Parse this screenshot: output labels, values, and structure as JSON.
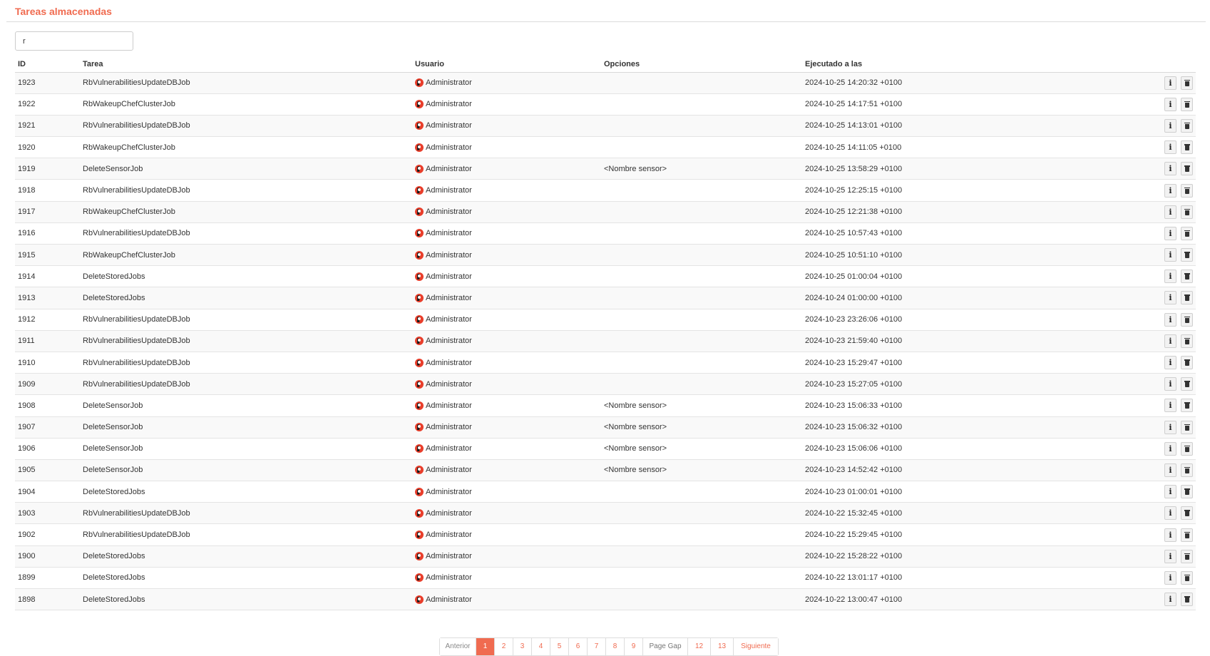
{
  "page": {
    "title": "Tareas almacenadas"
  },
  "search": {
    "value": "r"
  },
  "table": {
    "columns": [
      "ID",
      "Tarea",
      "Usuario",
      "Opciones",
      "Ejecutado a las"
    ],
    "rows": [
      {
        "id": "1923",
        "task": "RbVulnerabilitiesUpdateDBJob",
        "user": "Administrator",
        "options": "",
        "executed_at": "2024-10-25 14:20:32 +0100"
      },
      {
        "id": "1922",
        "task": "RbWakeupChefClusterJob",
        "user": "Administrator",
        "options": "",
        "executed_at": "2024-10-25 14:17:51 +0100"
      },
      {
        "id": "1921",
        "task": "RbVulnerabilitiesUpdateDBJob",
        "user": "Administrator",
        "options": "",
        "executed_at": "2024-10-25 14:13:01 +0100"
      },
      {
        "id": "1920",
        "task": "RbWakeupChefClusterJob",
        "user": "Administrator",
        "options": "",
        "executed_at": "2024-10-25 14:11:05 +0100"
      },
      {
        "id": "1919",
        "task": "DeleteSensorJob",
        "user": "Administrator",
        "options": "<Nombre sensor>",
        "executed_at": "2024-10-25 13:58:29 +0100"
      },
      {
        "id": "1918",
        "task": "RbVulnerabilitiesUpdateDBJob",
        "user": "Administrator",
        "options": "",
        "executed_at": "2024-10-25 12:25:15 +0100"
      },
      {
        "id": "1917",
        "task": "RbWakeupChefClusterJob",
        "user": "Administrator",
        "options": "",
        "executed_at": "2024-10-25 12:21:38 +0100"
      },
      {
        "id": "1916",
        "task": "RbVulnerabilitiesUpdateDBJob",
        "user": "Administrator",
        "options": "",
        "executed_at": "2024-10-25 10:57:43 +0100"
      },
      {
        "id": "1915",
        "task": "RbWakeupChefClusterJob",
        "user": "Administrator",
        "options": "",
        "executed_at": "2024-10-25 10:51:10 +0100"
      },
      {
        "id": "1914",
        "task": "DeleteStoredJobs",
        "user": "Administrator",
        "options": "",
        "executed_at": "2024-10-25 01:00:04 +0100"
      },
      {
        "id": "1913",
        "task": "DeleteStoredJobs",
        "user": "Administrator",
        "options": "",
        "executed_at": "2024-10-24 01:00:00 +0100"
      },
      {
        "id": "1912",
        "task": "RbVulnerabilitiesUpdateDBJob",
        "user": "Administrator",
        "options": "",
        "executed_at": "2024-10-23 23:26:06 +0100"
      },
      {
        "id": "1911",
        "task": "RbVulnerabilitiesUpdateDBJob",
        "user": "Administrator",
        "options": "",
        "executed_at": "2024-10-23 21:59:40 +0100"
      },
      {
        "id": "1910",
        "task": "RbVulnerabilitiesUpdateDBJob",
        "user": "Administrator",
        "options": "",
        "executed_at": "2024-10-23 15:29:47 +0100"
      },
      {
        "id": "1909",
        "task": "RbVulnerabilitiesUpdateDBJob",
        "user": "Administrator",
        "options": "",
        "executed_at": "2024-10-23 15:27:05 +0100"
      },
      {
        "id": "1908",
        "task": "DeleteSensorJob",
        "user": "Administrator",
        "options": "<Nombre sensor>",
        "executed_at": "2024-10-23 15:06:33 +0100"
      },
      {
        "id": "1907",
        "task": "DeleteSensorJob",
        "user": "Administrator",
        "options": "<Nombre sensor>",
        "executed_at": "2024-10-23 15:06:32 +0100"
      },
      {
        "id": "1906",
        "task": "DeleteSensorJob",
        "user": "Administrator",
        "options": "<Nombre sensor>",
        "executed_at": "2024-10-23 15:06:06 +0100"
      },
      {
        "id": "1905",
        "task": "DeleteSensorJob",
        "user": "Administrator",
        "options": "<Nombre sensor>",
        "executed_at": "2024-10-23 14:52:42 +0100"
      },
      {
        "id": "1904",
        "task": "DeleteStoredJobs",
        "user": "Administrator",
        "options": "",
        "executed_at": "2024-10-23 01:00:01 +0100"
      },
      {
        "id": "1903",
        "task": "RbVulnerabilitiesUpdateDBJob",
        "user": "Administrator",
        "options": "",
        "executed_at": "2024-10-22 15:32:45 +0100"
      },
      {
        "id": "1902",
        "task": "RbVulnerabilitiesUpdateDBJob",
        "user": "Administrator",
        "options": "",
        "executed_at": "2024-10-22 15:29:45 +0100"
      },
      {
        "id": "1900",
        "task": "DeleteStoredJobs",
        "user": "Administrator",
        "options": "",
        "executed_at": "2024-10-22 15:28:22 +0100"
      },
      {
        "id": "1899",
        "task": "DeleteStoredJobs",
        "user": "Administrator",
        "options": "",
        "executed_at": "2024-10-22 13:01:17 +0100"
      },
      {
        "id": "1898",
        "task": "DeleteStoredJobs",
        "user": "Administrator",
        "options": "",
        "executed_at": "2024-10-22 13:00:47 +0100"
      }
    ],
    "row_actions": [
      "info-icon",
      "trash-icon"
    ]
  },
  "pagination": {
    "previous": "Anterior",
    "next": "Siguiente",
    "gap": "Page Gap",
    "pages": [
      "1",
      "2",
      "3",
      "4",
      "5",
      "6",
      "7",
      "8",
      "9",
      "Page Gap",
      "12",
      "13"
    ],
    "current": "1"
  },
  "colors": {
    "accent": "#f06b50",
    "row_stripe": "#f9f9f9",
    "user_icon": "#e83e2b"
  }
}
